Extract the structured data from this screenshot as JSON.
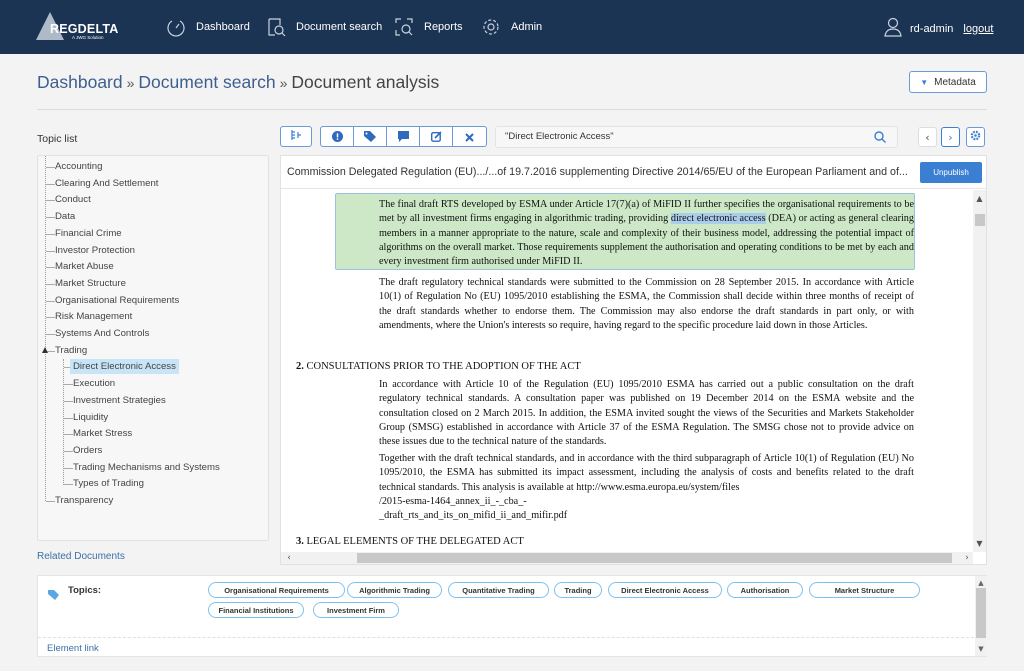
{
  "app": {
    "logo_text": "REGDELTA",
    "logo_sub": "A JWG Solution"
  },
  "nav": {
    "items": [
      {
        "label": "Dashboard",
        "icon": "dashboard-gauge-icon"
      },
      {
        "label": "Document search",
        "icon": "document-search-icon"
      },
      {
        "label": "Reports",
        "icon": "reports-scan-icon"
      },
      {
        "label": "Admin",
        "icon": "gear-icon"
      }
    ],
    "user": "rd-admin",
    "logout": "logout"
  },
  "breadcrumb": {
    "items": [
      "Dashboard",
      "Document search"
    ],
    "separator": "»",
    "current": "Document analysis"
  },
  "metadata_button": "Metadata",
  "topic_list": {
    "title": "Topic list",
    "items": [
      {
        "label": "Accounting",
        "level": 0
      },
      {
        "label": "Clearing And Settlement",
        "level": 0
      },
      {
        "label": "Conduct",
        "level": 0
      },
      {
        "label": "Data",
        "level": 0
      },
      {
        "label": "Financial Crime",
        "level": 0
      },
      {
        "label": "Investor Protection",
        "level": 0
      },
      {
        "label": "Market Abuse",
        "level": 0
      },
      {
        "label": "Market Structure",
        "level": 0
      },
      {
        "label": "Organisational Requirements",
        "level": 0
      },
      {
        "label": "Risk Management",
        "level": 0
      },
      {
        "label": "Systems And Controls",
        "level": 0
      },
      {
        "label": "Trading",
        "level": 0,
        "expanded": true
      },
      {
        "label": "Direct Electronic Access",
        "level": 1,
        "selected": true
      },
      {
        "label": "Execution",
        "level": 1
      },
      {
        "label": "Investment Strategies",
        "level": 1
      },
      {
        "label": "Liquidity",
        "level": 1
      },
      {
        "label": "Market Stress",
        "level": 1
      },
      {
        "label": "Orders",
        "level": 1
      },
      {
        "label": "Trading Mechanisms and Systems",
        "level": 1
      },
      {
        "label": "Types of Trading",
        "level": 1
      },
      {
        "label": "Transparency",
        "level": 0
      }
    ],
    "related_documents": "Related Documents"
  },
  "toolbar": {
    "tree_toggle_icon": "tree-structure-icon",
    "group_icons": [
      "exclamation-circle-icon",
      "tag-icon",
      "comment-icon",
      "edit-icon",
      "close-icon"
    ],
    "search_value": "\"Direct Electronic Access\"",
    "prev": "‹",
    "next": "›"
  },
  "document": {
    "title": "Commission Delegated Regulation (EU).../...of 19.7.2016 supplementing Directive 2014/65/EU of the European Parliament and of...",
    "unpublish": "Unpublish",
    "highlighted_para": {
      "before": "The final draft RTS developed by ESMA under Article 17(7)(a) of MiFID II further specifies the organisational requirements to be met by all investment firms engaging in algorithmic trading, providing ",
      "match": "direct electronic access",
      "after": " (DEA) or acting as general clearing members in a manner appropriate to the nature, scale and complexity of their business model, addressing the potential impact of algorithms on the overall market. Those requirements supplement the authorisation and operating conditions to be met by each and every investment firm authorised under MiFID II."
    },
    "para2": "The draft regulatory technical standards were submitted to the Commission on 28 September 2015. In accordance with Article 10(1) of Regulation No (EU) 1095/2010 establishing the ESMA, the Commission shall decide within three months of receipt of the draft standards whether to endorse them. The Commission may also endorse the draft standards in part only, or with amendments, where the Union's interests so require, having regard to the specific procedure laid down in those Articles.",
    "heading2_num": "2.",
    "heading2": "CONSULTATIONS PRIOR TO THE ADOPTION OF THE ACT",
    "para3": "In accordance with Article 10 of the Regulation (EU) 1095/2010 ESMA has carried out a public consultation on the draft regulatory technical standards. A consultation paper was published on 19 December 2014 on the ESMA website and the consultation closed on 2 March 2015. In addition, the ESMA invited sought the views of the Securities and Markets Stakeholder Group (SMSG) established in accordance with Article 37 of the ESMA Regulation. The SMSG chose not to provide advice on these issues due to the technical nature of the standards.",
    "para4_a": "Together with the draft technical standards, and in accordance with the third subparagraph of Article 10(1) of Regulation (EU) No 1095/2010, the ESMA has submitted its impact assessment, including the analysis of costs and benefits related to the draft technical standards. This analysis is available at http://www.esma.europa.eu/system/files",
    "para4_b": "/2015-esma-1464_annex_ii_-_cba_-",
    "para4_c": "_draft_rts_and_its_on_mifid_ii_and_mifir.pdf",
    "heading3_num": "3.",
    "heading3": "LEGAL ELEMENTS OF THE DELEGATED ACT"
  },
  "topics_panel": {
    "label": "Topics:",
    "chips": [
      "Organisational Requirements",
      "Algorithmic Trading",
      "Quantitative Trading",
      "Trading",
      "Direct Electronic Access",
      "Authorisation",
      "Market Structure",
      "Financial Institutions",
      "Investment Firm"
    ],
    "element_link": "Element link"
  },
  "colors": {
    "nav_bg": "#1c3454",
    "accent": "#3b7fd3",
    "highlight_para": "#cce8c6",
    "highlight_match": "#a9cdea",
    "tree_selected": "#c8e5f7",
    "chip_border": "#7ec2ef"
  }
}
